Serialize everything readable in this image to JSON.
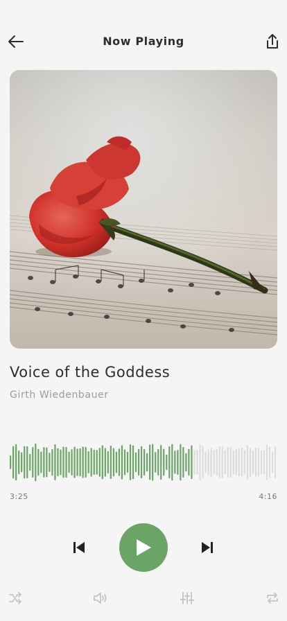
{
  "header": {
    "title": "Now Playing",
    "back_icon": "arrow-left-icon",
    "share_icon": "share-icon"
  },
  "artwork": {
    "subject": "red-rose-on-sheet-music",
    "colors": {
      "rose": "#d8332c",
      "paper": "#ddd3c8",
      "stem": "#3f4a22"
    }
  },
  "track": {
    "title": "Voice of the Goddess",
    "artist": "Girth Wiedenbauer"
  },
  "progress": {
    "current_time": "3:25",
    "total_time": "4:16",
    "played_fraction": 0.69,
    "bar_count": 96,
    "played_color": "#6ba565",
    "unplayed_color": "#dcdcdc"
  },
  "controls": {
    "previous_icon": "skip-previous-icon",
    "play_icon": "play-icon",
    "next_icon": "skip-next-icon",
    "accent": "#6ba565"
  },
  "bottom_bar": {
    "icons": [
      "shuffle-icon",
      "volume-icon",
      "equalizer-icon",
      "repeat-icon"
    ],
    "icon_color": "#c4c4c4"
  }
}
